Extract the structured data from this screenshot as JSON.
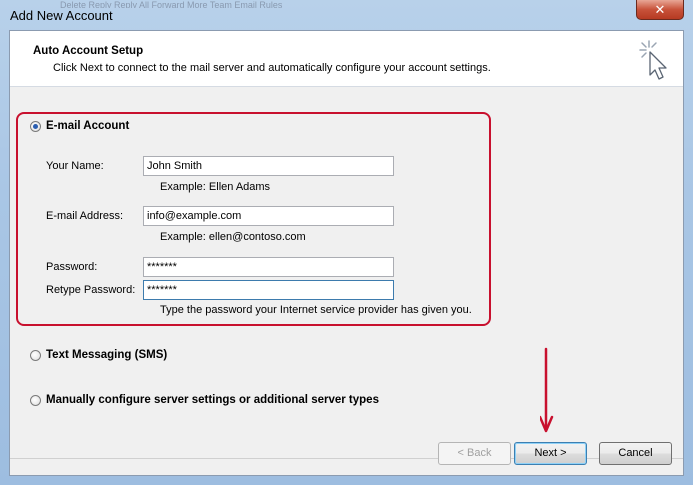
{
  "window": {
    "title": "Add New Account",
    "close_label": "✕"
  },
  "background_toolbar": {
    "text": "Delete   Reply   Reply All   Forward   More   Team Email   Rules"
  },
  "header": {
    "title": "Auto Account Setup",
    "subtitle": "Click Next to connect to the mail server and automatically configure your account settings."
  },
  "options": {
    "email": {
      "label": "E-mail Account",
      "selected": true
    },
    "sms": {
      "label": "Text Messaging (SMS)",
      "selected": false
    },
    "manual": {
      "label": "Manually configure server settings or additional server types",
      "selected": false
    }
  },
  "fields": {
    "name": {
      "label": "Your Name:",
      "value": "John Smith",
      "example": "Example: Ellen Adams"
    },
    "email": {
      "label": "E-mail Address:",
      "value": "info@example.com",
      "example": "Example: ellen@contoso.com"
    },
    "password": {
      "label": "Password:",
      "value": "*******"
    },
    "retype": {
      "label": "Retype Password:",
      "value": "*******",
      "hint": "Type the password your Internet service provider has given you."
    }
  },
  "buttons": {
    "back": "< Back",
    "next": "Next >",
    "cancel": "Cancel"
  },
  "colors": {
    "annotation": "#c8102e",
    "accent": "#2a5db0"
  }
}
